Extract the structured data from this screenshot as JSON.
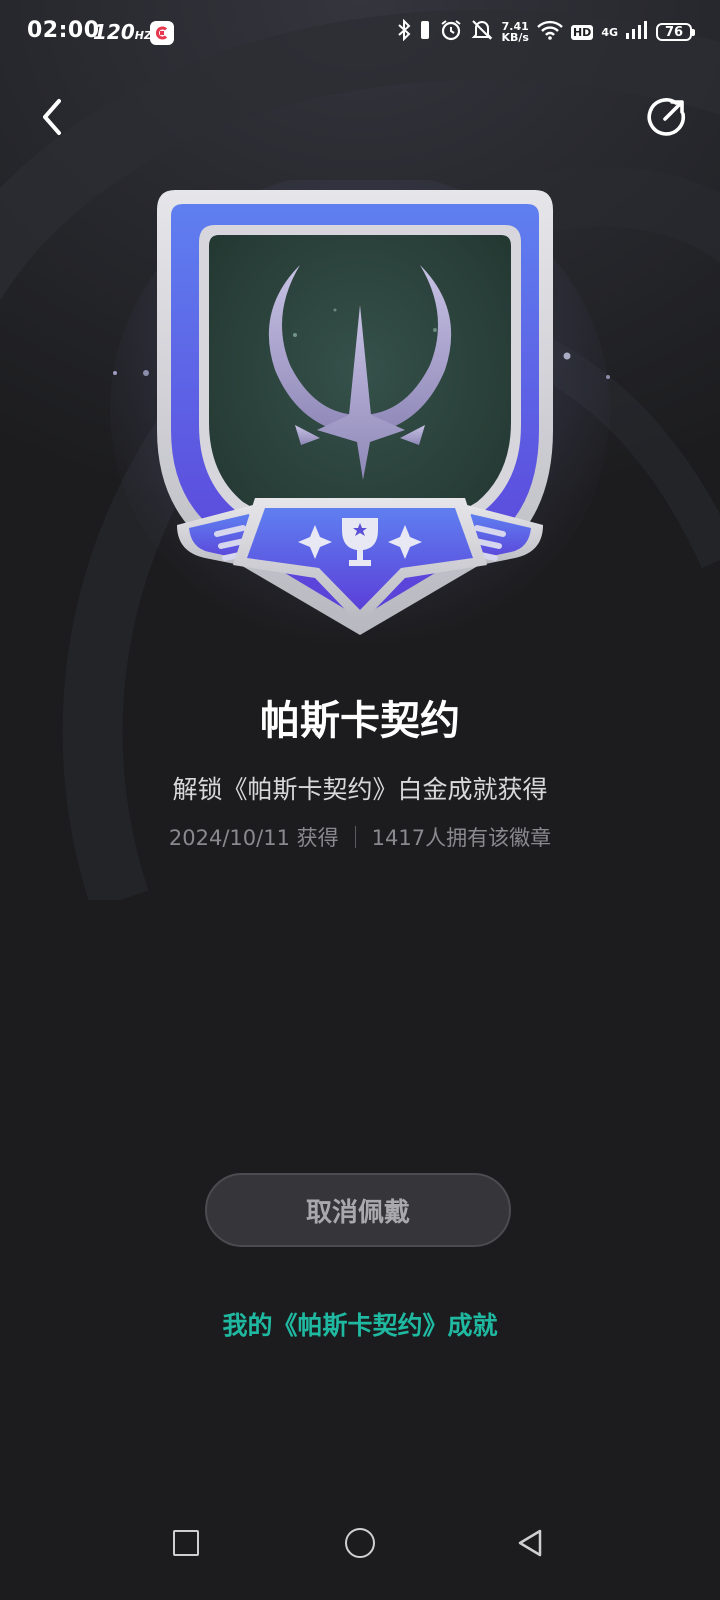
{
  "status_bar": {
    "time": "02:00",
    "refresh_rate": "120",
    "refresh_unit": "HZ",
    "speed_value": "7.41",
    "speed_unit": "KB/s",
    "hd_label": "HD",
    "network": "4G",
    "battery": "76",
    "icons": [
      "app-c-icon",
      "bluetooth-icon",
      "vibrate-icon",
      "alarm-icon",
      "mute-icon",
      "wifi-icon",
      "signal-icon",
      "battery-icon"
    ]
  },
  "header": {
    "back_icon": "chevron-left-icon",
    "share_icon": "share-icon"
  },
  "badge": {
    "icon": "achievement-badge-icon",
    "colors": {
      "frame": "#c9c9d0",
      "blue": "#5a5de0",
      "inner": "#2e463d",
      "emblem": "#a9a2c9"
    }
  },
  "badge_title": "帕斯卡契约",
  "badge_desc": "解锁《帕斯卡契约》白金成就获得",
  "meta": {
    "date": "2024/10/11 获得",
    "owners": "1417人拥有该徽章"
  },
  "cancel_button": "取消佩戴",
  "achievements_link": "我的《帕斯卡契约》成就",
  "accent_color": "#1fb8a0"
}
